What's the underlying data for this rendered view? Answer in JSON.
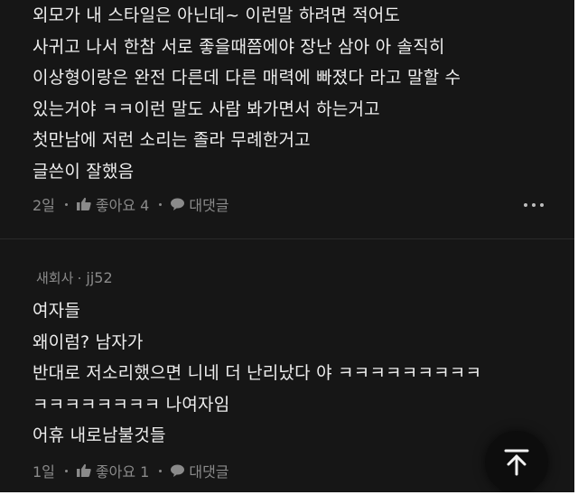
{
  "comments": [
    {
      "lines": [
        "외모가 내 스타일은 아닌데~ 이런말 하려면 적어도",
        "사귀고 나서 한참 서로 좋을때쯤에야 장난 삼아 아 솔직히",
        "이상형이랑은 완전 다른데 다른 매력에 빠졌다 라고 말할 수",
        "있는거야 ㅋㅋ이런 말도 사람 봐가면서 하는거고",
        "첫만남에 저런 소리는 졸라 무례한거고",
        "글쓴이 잘했음"
      ],
      "time": "2일",
      "like_label": "좋아요 4",
      "reply_label": "대댓글",
      "icons": [
        "thumbs-up-icon",
        "speech-bubble-icon",
        "more-dots-icon"
      ]
    },
    {
      "author_group": "새회사",
      "author_name": "jj52",
      "lines": [
        "여자들",
        "왜이럼? 남자가",
        "반대로 저소리했으면 니네 더 난리났다 야 ㅋㅋㅋㅋㅋㅋㅋㅋㅋ",
        "ㅋㅋㅋㅋㅋㅋㅋㅋ 나여자임",
        "어휴 내로남불것들"
      ],
      "time": "1일",
      "like_label": "좋아요 1",
      "reply_label": "대댓글",
      "icons": [
        "thumbs-up-icon",
        "speech-bubble-icon"
      ]
    }
  ],
  "scroll_top_icon": "arrow-up-icon",
  "colors": {
    "background": "#161616",
    "text": "#eeeeee",
    "meta": "#8a8a8a"
  }
}
